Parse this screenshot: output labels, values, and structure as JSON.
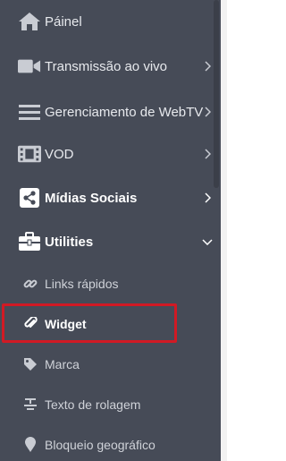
{
  "menu": [
    {
      "label": "Páinel",
      "icon": "home-icon"
    },
    {
      "label": "Transmissão ao vivo",
      "icon": "video-camera-icon"
    },
    {
      "label": "Gerenciamento de WebTV",
      "icon": "menu-bars-icon"
    },
    {
      "label": "VOD",
      "icon": "film-icon"
    },
    {
      "label": "Mídias Sociais",
      "icon": "share-icon"
    },
    {
      "label": "Utilities",
      "icon": "toolbox-icon"
    }
  ],
  "submenu": [
    {
      "label": "Links rápidos",
      "icon": "link-icon"
    },
    {
      "label": "Widget",
      "icon": "paperclip-icon"
    },
    {
      "label": "Marca",
      "icon": "tag-icon"
    },
    {
      "label": "Texto de rolagem",
      "icon": "text-scroll-icon"
    },
    {
      "label": "Bloqueio geográfico",
      "icon": "map-pin-icon"
    }
  ],
  "colors": {
    "sidebar_bg": "#464b57",
    "highlight_border": "#d11a24",
    "text": "#e7e9ed"
  }
}
